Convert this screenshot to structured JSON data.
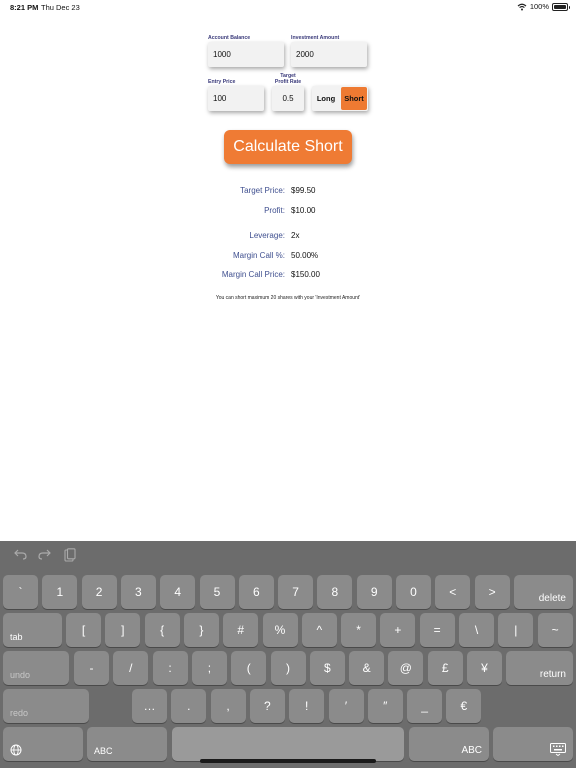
{
  "status_bar": {
    "time": "8:21 PM",
    "date": "Thu Dec 23",
    "battery_text": "100%",
    "battery_level": 1.0
  },
  "form": {
    "account_balance": {
      "label": "Account Balance",
      "value": "1000"
    },
    "investment_amount": {
      "label": "Investment Amount",
      "value": "2000"
    },
    "entry_price": {
      "label": "Entry Price",
      "value": "100"
    },
    "target_profit_rate": {
      "label_line1": "Target",
      "label_line2": "Profit Rate",
      "value": "0.5"
    },
    "position": {
      "long_label": "Long",
      "short_label": "Short",
      "selected": "Short"
    },
    "calculate_label": "Calculate Short"
  },
  "results": {
    "target_price": {
      "label": "Target Price:",
      "value": "$99.50"
    },
    "profit": {
      "label": "Profit:",
      "value": "$10.00"
    },
    "leverage": {
      "label": "Leverage:",
      "value": "2x"
    },
    "margin_call_pct": {
      "label": "Margin Call %:",
      "value": "50.00%"
    },
    "margin_call_price": {
      "label": "Margin Call Price:",
      "value": "$150.00"
    },
    "note": "You can short maximum 20 shares with your 'Investment Amount'"
  },
  "colors": {
    "accent": "#ee7a32",
    "label_blue": "#3f4f8f",
    "keyboard_bg": "#6c6c6c",
    "key_bg": "#8b8b8b"
  },
  "keyboard": {
    "toolbar_icons": [
      "undo-icon",
      "redo-icon",
      "paste-icon"
    ],
    "row1": [
      "`",
      "1",
      "2",
      "3",
      "4",
      "5",
      "6",
      "7",
      "8",
      "9",
      "0",
      "<",
      ">"
    ],
    "delete_label": "delete",
    "tab_label": "tab",
    "row2": [
      "[",
      "]",
      "{",
      "}",
      "#",
      "%",
      "^",
      "*",
      "+",
      "=",
      "\\",
      "|",
      "~"
    ],
    "undo_label": "undo",
    "row3": [
      "-",
      "/",
      ":",
      ";",
      "(",
      ")",
      "$",
      "&",
      "@",
      "£",
      "¥"
    ],
    "return_label": "return",
    "redo_label": "redo",
    "row4": [
      "…",
      ".",
      ",",
      "?",
      "!",
      "′",
      "″",
      "_",
      "€"
    ],
    "abc_label": "ABC",
    "globe_icon": "globe-icon",
    "dismiss_icon": "keyboard-dismiss-icon"
  }
}
